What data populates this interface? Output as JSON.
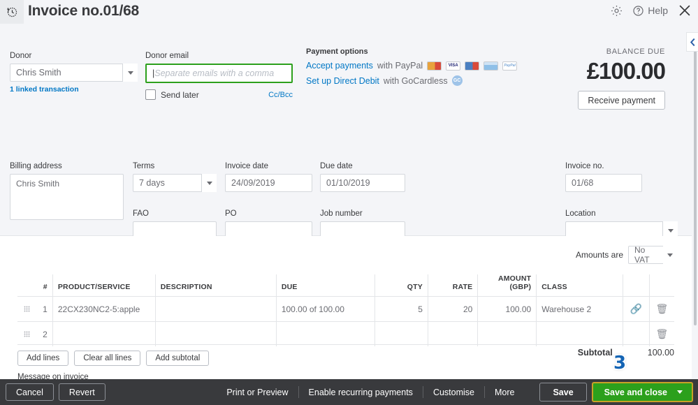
{
  "header": {
    "history_icon": "clock-history-icon",
    "title": "Invoice no.01/68",
    "gear_icon": "gear-icon",
    "help_icon": "help-circle-icon",
    "help_label": "Help",
    "close_icon": "close-icon"
  },
  "donor": {
    "label": "Donor",
    "value": "Chris Smith",
    "linked_transaction": "1 linked transaction"
  },
  "donor_email": {
    "label": "Donor email",
    "value": "",
    "placeholder": "Separate emails with a comma",
    "send_later_label": "Send later",
    "send_later_checked": false,
    "ccbcc_label": "Cc/Bcc",
    "focus_color": "#2ca01c"
  },
  "payment_options": {
    "label": "Payment options",
    "rows": [
      {
        "link_text": "Accept payments",
        "suffix": "with PayPal",
        "icons": [
          "mastercard-icon",
          "visa-icon",
          "maestro-icon",
          "card-icon",
          "paypal-icon"
        ]
      },
      {
        "link_text": "Set up Direct Debit",
        "suffix": "with GoCardless",
        "icons": [
          "gocardless-icon"
        ]
      }
    ],
    "link_color": "#0077c5"
  },
  "balance": {
    "label": "BALANCE DUE",
    "amount": "£100.00",
    "receive_payment_label": "Receive payment"
  },
  "fields": {
    "billing_address": {
      "label": "Billing address",
      "value": "Chris Smith"
    },
    "terms": {
      "label": "Terms",
      "value": "7 days"
    },
    "invoice_date": {
      "label": "Invoice date",
      "value": "24/09/2019"
    },
    "due_date": {
      "label": "Due date",
      "value": "01/10/2019"
    },
    "fao": {
      "label": "FAO",
      "value": ""
    },
    "po": {
      "label": "PO",
      "value": ""
    },
    "job_number": {
      "label": "Job number",
      "value": ""
    },
    "invoice_no": {
      "label": "Invoice no.",
      "value": "01/68"
    },
    "location": {
      "label": "Location",
      "value": ""
    }
  },
  "vat": {
    "label": "Amounts are",
    "value": "No VAT"
  },
  "table": {
    "columns": [
      "",
      "#",
      "PRODUCT/SERVICE",
      "DESCRIPTION",
      "DUE",
      "QTY",
      "RATE",
      "AMOUNT (GBP)",
      "CLASS",
      "",
      ""
    ],
    "rows": [
      {
        "drag": "drag-handle-icon",
        "num": "1",
        "product": "22CX230NC2-5:apple",
        "description": "",
        "due": "100.00 of 100.00",
        "qty": "5",
        "rate": "20",
        "amount": "100.00",
        "class": "Warehouse 2",
        "link_icon": "link-icon",
        "delete_icon": "trash-icon"
      },
      {
        "drag": "drag-handle-icon",
        "num": "2",
        "product": "",
        "description": "",
        "due": "",
        "qty": "",
        "rate": "",
        "amount": "",
        "class": "",
        "link_icon": "",
        "delete_icon": "trash-icon"
      }
    ]
  },
  "line_actions": {
    "add_lines": "Add lines",
    "clear_all_lines": "Clear all lines",
    "add_subtotal": "Add subtotal"
  },
  "subtotal": {
    "label": "Subtotal",
    "value": "100.00"
  },
  "message_label": "Message on invoice",
  "annotation": {
    "marker": "3",
    "color": "#1464b4"
  },
  "collapse": {
    "icon": "chevron-left-icon"
  },
  "footer": {
    "cancel": "Cancel",
    "revert": "Revert",
    "links": [
      "Print or Preview",
      "Enable recurring payments",
      "Customise",
      "More"
    ],
    "save": "Save",
    "save_and_close": "Save and close",
    "save_color": "#2ca01c"
  }
}
